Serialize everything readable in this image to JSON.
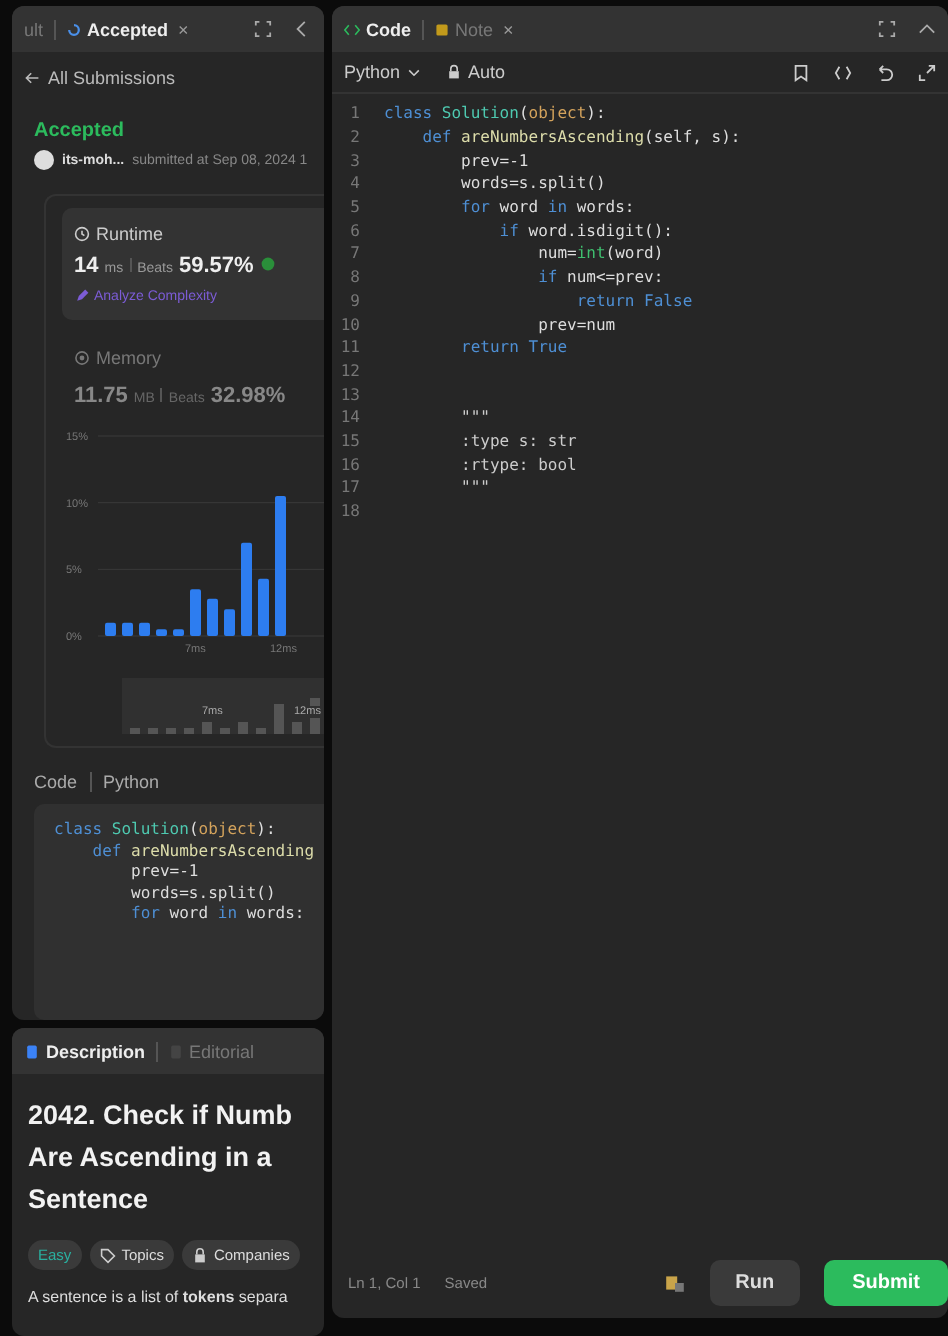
{
  "left_panel": {
    "tabs": [
      {
        "label": "ult",
        "selected": false
      },
      {
        "label": "Accepted",
        "selected": true,
        "close": "×"
      }
    ],
    "back_link": "All Submissions",
    "status": "Accepted",
    "user": "its-moh...",
    "submitted": "submitted at Sep 08, 2024 1",
    "runtime": {
      "title": "Runtime",
      "value": "14",
      "unit": "ms",
      "beats_label": "Beats",
      "beats": "59.57%",
      "analyze": "Analyze Complexity"
    },
    "memory": {
      "title": "Memory",
      "value": "11.75",
      "unit": "MB",
      "beats_label": "Beats",
      "beats": "32.98%"
    },
    "chart_data": {
      "type": "bar",
      "categories": [
        null,
        null,
        null,
        null,
        null,
        "7ms",
        null,
        null,
        null,
        null,
        "12ms"
      ],
      "values": [
        1,
        1,
        1,
        0.5,
        0.5,
        3.5,
        2.8,
        2,
        7,
        4.3,
        10.5
      ],
      "ylim": [
        0,
        15
      ],
      "yticks": [
        {
          "value": 0,
          "label": "0%"
        },
        {
          "value": 5,
          "label": "5%"
        },
        {
          "value": 10,
          "label": "10%"
        },
        {
          "value": 15,
          "label": "15%"
        }
      ]
    },
    "overview_labels": [
      "7ms",
      "12ms"
    ],
    "code_header": {
      "title": "Code",
      "language": "Python"
    },
    "code": [
      [
        {
          "kind": "kw",
          "text": "class "
        },
        {
          "kind": "cls",
          "text": "Solution"
        },
        {
          "kind": "p",
          "text": "("
        },
        {
          "kind": "obj",
          "text": "object"
        },
        {
          "kind": "p",
          "text": "):"
        }
      ],
      [
        {
          "kind": "kw",
          "text": "    def "
        },
        {
          "kind": "fn",
          "text": "areNumbersAscending"
        }
      ],
      [
        {
          "kind": "p",
          "text": "        prev=-1"
        }
      ],
      [
        {
          "kind": "p",
          "text": "        words=s.split()"
        }
      ],
      [
        {
          "kind": "kw",
          "text": "        for"
        },
        {
          "kind": "p",
          "text": " word "
        },
        {
          "kind": "kw",
          "text": "in"
        },
        {
          "kind": "p",
          "text": " words:"
        }
      ]
    ]
  },
  "description_panel": {
    "tabs": [
      {
        "label": "Description",
        "selected": true
      },
      {
        "label": "Editorial",
        "selected": false
      }
    ],
    "title": "2042. Check if Numb Are Ascending in a Sentence",
    "tags": [
      {
        "label": "Easy",
        "kind": "difficulty"
      },
      {
        "label": "Topics",
        "kind": "topics"
      },
      {
        "label": "Companies",
        "kind": "companies"
      }
    ],
    "text": "A sentence is a list of **tokens** separa"
  },
  "editor": {
    "tabs": [
      {
        "label": "Code",
        "selected": true
      },
      {
        "label": "Note",
        "selected": false,
        "close": "×"
      }
    ],
    "language": "Python",
    "mode": "Auto",
    "lines": [
      {
        "number": "1",
        "tokens": [
          {
            "kind": "kw",
            "text": "class "
          },
          {
            "kind": "cls",
            "text": "Solution"
          },
          {
            "kind": "p",
            "text": "("
          },
          {
            "kind": "obj",
            "text": "object"
          },
          {
            "kind": "p",
            "text": "):"
          }
        ]
      },
      {
        "number": "2",
        "tokens": [
          {
            "kind": "kw",
            "text": "    def "
          },
          {
            "kind": "fn",
            "text": "areNumbersAscending"
          },
          {
            "kind": "p",
            "text": "(self, s):"
          }
        ]
      },
      {
        "number": "3",
        "tokens": [
          {
            "kind": "p",
            "text": "        prev=-1"
          }
        ]
      },
      {
        "number": "4",
        "tokens": [
          {
            "kind": "p",
            "text": "        words=s.split()"
          }
        ]
      },
      {
        "number": "5",
        "tokens": [
          {
            "kind": "kw",
            "text": "        for"
          },
          {
            "kind": "p",
            "text": " word "
          },
          {
            "kind": "kw",
            "text": "in"
          },
          {
            "kind": "p",
            "text": " words:"
          }
        ]
      },
      {
        "number": "6",
        "tokens": [
          {
            "kind": "kw",
            "text": "            if"
          },
          {
            "kind": "p",
            "text": " word.isdigit():"
          }
        ]
      },
      {
        "number": "7",
        "tokens": [
          {
            "kind": "p",
            "text": "                num="
          },
          {
            "kind": "bi",
            "text": "int"
          },
          {
            "kind": "p",
            "text": "(word)"
          }
        ]
      },
      {
        "number": "8",
        "tokens": [
          {
            "kind": "kw",
            "text": "                if"
          },
          {
            "kind": "p",
            "text": " num<=prev:"
          }
        ]
      },
      {
        "number": "9",
        "tokens": [
          {
            "kind": "kw",
            "text": "                    return "
          },
          {
            "kind": "const",
            "text": "False"
          }
        ]
      },
      {
        "number": "10",
        "tokens": [
          {
            "kind": "p",
            "text": "                prev=num"
          }
        ]
      },
      {
        "number": "11",
        "tokens": [
          {
            "kind": "kw",
            "text": "        return "
          },
          {
            "kind": "const",
            "text": "True"
          }
        ]
      },
      {
        "number": "12"
      },
      {
        "number": "13"
      },
      {
        "number": "14",
        "tokens": [
          {
            "kind": "str",
            "text": "        \"\"\""
          }
        ]
      },
      {
        "number": "15",
        "tokens": [
          {
            "kind": "str",
            "text": "        :type s: str"
          }
        ]
      },
      {
        "number": "16",
        "tokens": [
          {
            "kind": "str",
            "text": "        :rtype: bool"
          }
        ]
      },
      {
        "number": "17",
        "tokens": [
          {
            "kind": "str",
            "text": "        \"\"\""
          }
        ]
      },
      {
        "number": "18"
      }
    ],
    "cursor": "Ln 1, Col 1",
    "save_status": "Saved",
    "run": "Run",
    "submit": "Submit"
  }
}
